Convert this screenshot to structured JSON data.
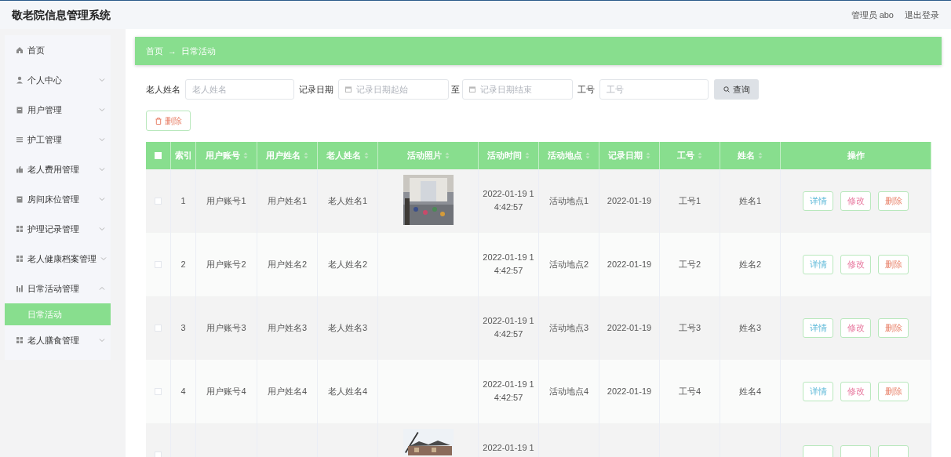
{
  "header": {
    "title": "敬老院信息管理系统",
    "user": "管理员 abo",
    "logout": "退出登录"
  },
  "sidebar": {
    "items": [
      {
        "label": "首页"
      },
      {
        "label": "个人中心",
        "expanded": false
      },
      {
        "label": "用户管理",
        "expanded": false
      },
      {
        "label": "护工管理",
        "expanded": false
      },
      {
        "label": "老人费用管理",
        "expanded": false
      },
      {
        "label": "房间床位管理",
        "expanded": false
      },
      {
        "label": "护理记录管理",
        "expanded": false
      },
      {
        "label": "老人健康档案管理",
        "expanded": false
      },
      {
        "label": "日常活动管理",
        "expanded": true,
        "children": [
          {
            "label": "日常活动",
            "selected": true
          }
        ]
      },
      {
        "label": "老人膳食管理",
        "expanded": false
      }
    ]
  },
  "breadcrumb": [
    "首页",
    "→",
    "日常活动"
  ],
  "filters": [
    {
      "kind": "text",
      "label": "老人姓名",
      "placeholder": "老人姓名"
    },
    {
      "kind": "date",
      "label": "记录日期",
      "placeholder": "记录日期起始"
    },
    {
      "kind": "date",
      "label": "至",
      "placeholder": "记录日期结束"
    },
    {
      "kind": "text",
      "label": "工号",
      "placeholder": "工号"
    }
  ],
  "search_button": "查询",
  "delete_button": "删除",
  "table": {
    "all_checked": false,
    "columns": [
      {
        "label": "索引",
        "sortable": false
      },
      {
        "label": "用户账号",
        "sortable": true
      },
      {
        "label": "用户姓名",
        "sortable": true
      },
      {
        "label": "老人姓名",
        "sortable": true
      },
      {
        "label": "活动照片",
        "sortable": true
      },
      {
        "label": "活动时间",
        "sortable": true
      },
      {
        "label": "活动地点",
        "sortable": true
      },
      {
        "label": "记录日期",
        "sortable": true
      },
      {
        "label": "工号",
        "sortable": true
      },
      {
        "label": "姓名",
        "sortable": true
      },
      {
        "label": "操作",
        "sortable": false
      }
    ],
    "rows": [
      {
        "checked": false,
        "index": "1",
        "account": "用户账号1",
        "user_name": "用户姓名1",
        "elder_name": "老人姓名1",
        "photo": true,
        "time": [
          "2022-01-19 1",
          "4:42:57"
        ],
        "place": "活动地点1",
        "date": "2022-01-19",
        "job_no": "工号1",
        "name": "姓名1",
        "actions": [
          {
            "kind": "detail",
            "label": "详情"
          },
          {
            "kind": "edit",
            "label": "修改"
          },
          {
            "kind": "delete",
            "label": "删除"
          }
        ]
      },
      {
        "checked": false,
        "index": "2",
        "account": "用户账号2",
        "user_name": "用户姓名2",
        "elder_name": "老人姓名2",
        "photo": false,
        "time": [
          "2022-01-19 1",
          "4:42:57"
        ],
        "place": "活动地点2",
        "date": "2022-01-19",
        "job_no": "工号2",
        "name": "姓名2",
        "actions": [
          {
            "kind": "detail",
            "label": "详情"
          },
          {
            "kind": "edit",
            "label": "修改"
          },
          {
            "kind": "delete",
            "label": "删除"
          }
        ]
      },
      {
        "checked": false,
        "index": "3",
        "account": "用户账号3",
        "user_name": "用户姓名3",
        "elder_name": "老人姓名3",
        "photo": false,
        "time": [
          "2022-01-19 1",
          "4:42:57"
        ],
        "place": "活动地点3",
        "date": "2022-01-19",
        "job_no": "工号3",
        "name": "姓名3",
        "actions": [
          {
            "kind": "detail",
            "label": "详情"
          },
          {
            "kind": "edit",
            "label": "修改"
          },
          {
            "kind": "delete",
            "label": "删除"
          }
        ]
      },
      {
        "checked": false,
        "index": "4",
        "account": "用户账号4",
        "user_name": "用户姓名4",
        "elder_name": "老人姓名4",
        "photo": false,
        "time": [
          "2022-01-19 1",
          "4:42:57"
        ],
        "place": "活动地点4",
        "date": "2022-01-19",
        "job_no": "工号4",
        "name": "姓名4",
        "actions": [
          {
            "kind": "detail",
            "label": "详情"
          },
          {
            "kind": "edit",
            "label": "修改"
          },
          {
            "kind": "delete",
            "label": "删除"
          }
        ]
      },
      {
        "checked": false,
        "photo": true,
        "time": [
          "2022-01-19 1"
        ],
        "actions": [
          {
            "kind": "detail"
          },
          {
            "kind": "edit"
          },
          {
            "kind": "delete"
          }
        ]
      }
    ]
  }
}
